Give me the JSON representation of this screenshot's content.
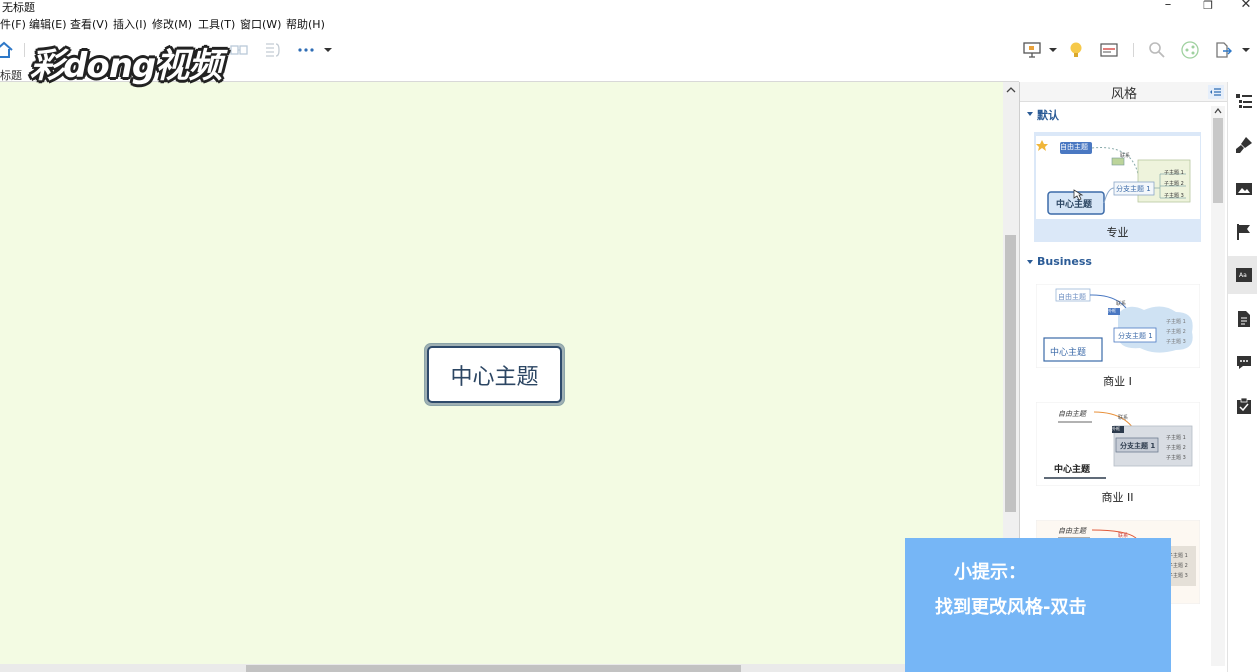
{
  "window": {
    "title": "无标题",
    "minimize": "–",
    "restore": "❐",
    "close": "✕"
  },
  "menu": [
    "件(F)",
    "编辑(E)",
    "查看(V)",
    "插入(I)",
    "修改(M)",
    "工具(T)",
    "窗口(W)",
    "帮助(H)"
  ],
  "tab": {
    "label": "标题"
  },
  "watermark": {
    "text": "彩dong视频"
  },
  "canvas": {
    "background": "#f3fbe3",
    "central_topic": "中心主题"
  },
  "style_panel": {
    "title": "风格",
    "sections": [
      {
        "name": "默认",
        "items": [
          {
            "label": "专业",
            "selected": true,
            "preview": {
              "float": "自由主题",
              "link": "联系",
              "central": "中心主题",
              "branch": "分支主题 1",
              "subs": [
                "子主题 1",
                "子主题 2",
                "子主题 3"
              ]
            }
          }
        ]
      },
      {
        "name": "Business",
        "items": [
          {
            "label": "商业 I",
            "selected": false,
            "preview": {
              "float": "自由主题",
              "link": "联系",
              "note": "外框",
              "central": "中心主题",
              "branch": "分支主题 1",
              "subs": [
                "子主题 1",
                "子主题 2",
                "子主题 3"
              ]
            }
          },
          {
            "label": "商业 II",
            "selected": false,
            "preview": {
              "float": "自由主题",
              "link": "联系",
              "note": "外框",
              "central": "中心主题",
              "branch": "分支主题 1",
              "subs": [
                "子主题 1",
                "子主题 2",
                "子主题 3"
              ]
            }
          },
          {
            "label": "",
            "selected": false,
            "preview": {
              "float": "自由主题",
              "link": "联系",
              "subs": [
                "子主题 1",
                "子主题 2",
                "子主题 3"
              ]
            }
          }
        ]
      }
    ]
  },
  "tip": {
    "line1": "小提示：",
    "line2": "找到更改风格-双击"
  },
  "colors": {
    "accent": "#2b5b96",
    "tip_bg": "#76b6f6",
    "topic_border": "#2e4a6b"
  }
}
